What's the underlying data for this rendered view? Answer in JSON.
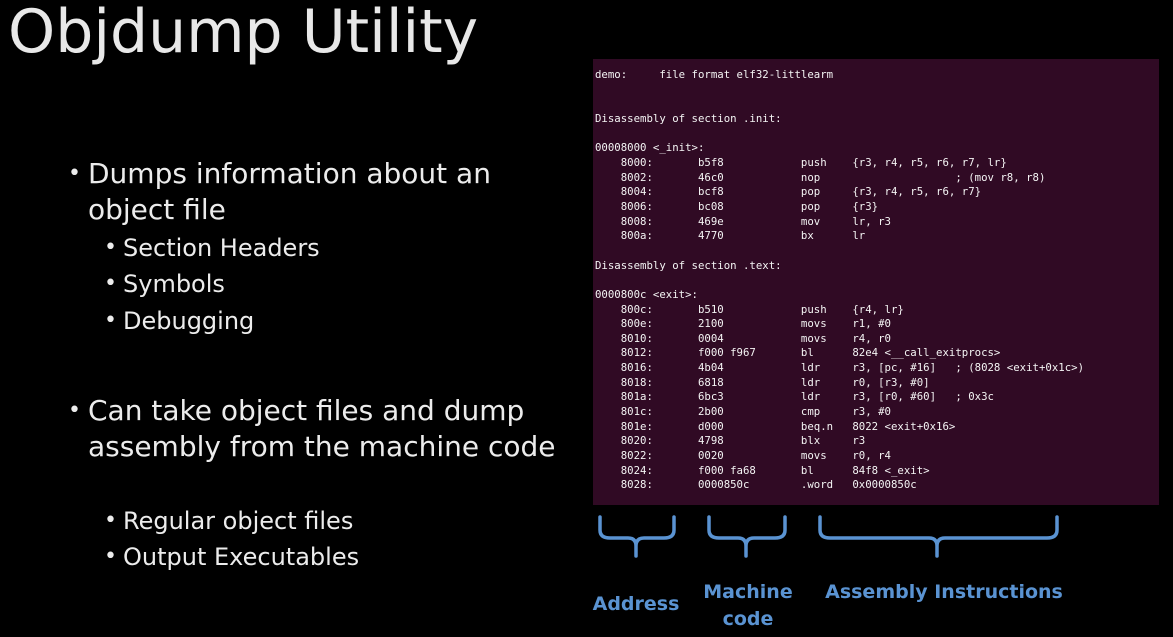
{
  "slide": {
    "title": "Objdump Utility",
    "bullets": [
      {
        "text": "Dumps information about an object file",
        "subitems": [
          "Section Headers",
          "Symbols",
          "Debugging"
        ]
      },
      {
        "text": "Can take object files and dump assembly from the machine code",
        "subitems": [
          "Regular object files",
          "Output Executables"
        ]
      }
    ]
  },
  "terminal": {
    "background": "#300a24",
    "lines": [
      "demo:     file format elf32-littlearm",
      "",
      "",
      "Disassembly of section .init:",
      "",
      "00008000 <_init>:",
      "    8000:       b5f8            push    {r3, r4, r5, r6, r7, lr}",
      "    8002:       46c0            nop                     ; (mov r8, r8)",
      "    8004:       bcf8            pop     {r3, r4, r5, r6, r7}",
      "    8006:       bc08            pop     {r3}",
      "    8008:       469e            mov     lr, r3",
      "    800a:       4770            bx      lr",
      "",
      "Disassembly of section .text:",
      "",
      "0000800c <exit>:",
      "    800c:       b510            push    {r4, lr}",
      "    800e:       2100            movs    r1, #0",
      "    8010:       0004            movs    r4, r0",
      "    8012:       f000 f967       bl      82e4 <__call_exitprocs>",
      "    8016:       4b04            ldr     r3, [pc, #16]   ; (8028 <exit+0x1c>)",
      "    8018:       6818            ldr     r0, [r3, #0]",
      "    801a:       6bc3            ldr     r3, [r0, #60]   ; 0x3c",
      "    801c:       2b00            cmp     r3, #0",
      "    801e:       d000            beq.n   8022 <exit+0x16>",
      "    8020:       4798            blx     r3",
      "    8022:       0020            movs    r0, r4",
      "    8024:       f000 fa68       bl      84f8 <_exit>",
      "    8028:       0000850c        .word   0x0000850c"
    ]
  },
  "annotations": {
    "color": "#5a93d2",
    "address_label": "Address",
    "machine_code_label_1": "Machine",
    "machine_code_label_2": "code",
    "assembly_label": "Assembly Instructions"
  }
}
